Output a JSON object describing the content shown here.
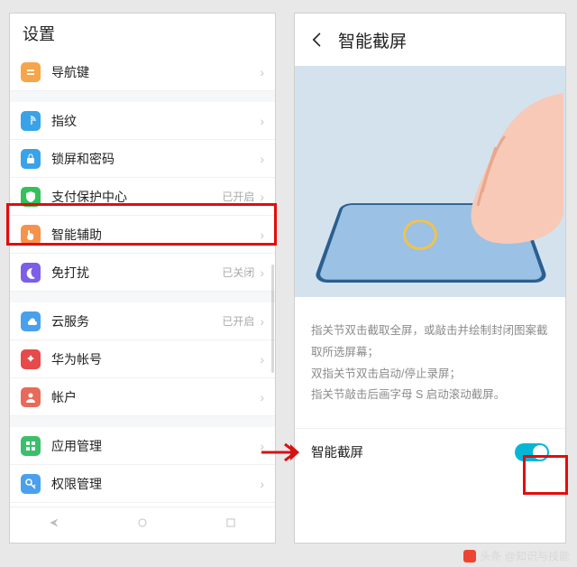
{
  "left": {
    "title": "设置",
    "rows": [
      {
        "icon": "nav-icon",
        "color": "#f6a54a",
        "label": "导航键",
        "status": ""
      },
      {
        "icon": "fingerprint-icon",
        "color": "#3aa3e8",
        "label": "指纹",
        "status": ""
      },
      {
        "icon": "lock-icon",
        "color": "#3aa3e8",
        "label": "锁屏和密码",
        "status": ""
      },
      {
        "icon": "shield-icon",
        "color": "#34c05a",
        "label": "支付保护中心",
        "status": "已开启"
      },
      {
        "icon": "hand-icon",
        "color": "#f6924a",
        "label": "智能辅助",
        "status": ""
      },
      {
        "icon": "moon-icon",
        "color": "#7c5fe6",
        "label": "免打扰",
        "status": "已关闭"
      },
      {
        "icon": "cloud-icon",
        "color": "#4aa0ec",
        "label": "云服务",
        "status": "已开启"
      },
      {
        "icon": "huawei-icon",
        "color": "#e74a4a",
        "label": "华为帐号",
        "status": ""
      },
      {
        "icon": "account-icon",
        "color": "#e86a5a",
        "label": "帐户",
        "status": ""
      },
      {
        "icon": "apps-icon",
        "color": "#3bbf6a",
        "label": "应用管理",
        "status": ""
      },
      {
        "icon": "key-icon",
        "color": "#4aa0ec",
        "label": "权限管理",
        "status": ""
      }
    ]
  },
  "right": {
    "title": "智能截屏",
    "desc1": "指关节双击截取全屏，或敲击并绘制封闭图案截取所选屏幕；",
    "desc2": "双指关节双击启动/停止录屏；",
    "desc3": "指关节敲击后画字母 S 启动滚动截屏。",
    "toggle_label": "智能截屏",
    "toggle_on": true
  },
  "attribution": "头条 @知识与技能"
}
